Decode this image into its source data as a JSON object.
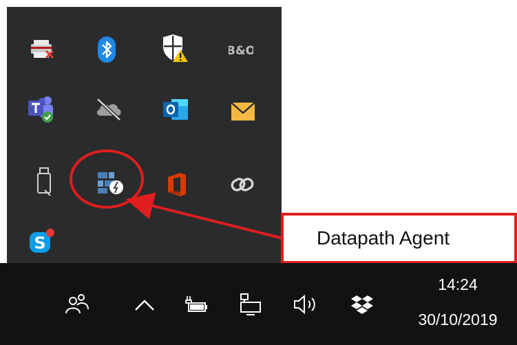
{
  "flyout": {
    "icons": [
      {
        "name": "printer-error-icon",
        "label": ""
      },
      {
        "name": "bluetooth-icon",
        "label": ""
      },
      {
        "name": "windows-security-warning-icon",
        "label": ""
      },
      {
        "name": "bang-olufsen-icon",
        "label": "B&O"
      },
      {
        "name": "teams-icon",
        "label": ""
      },
      {
        "name": "onedrive-offline-icon",
        "label": ""
      },
      {
        "name": "outlook-icon",
        "label": ""
      },
      {
        "name": "mail-icon",
        "label": ""
      },
      {
        "name": "usb-drive-icon",
        "label": ""
      },
      {
        "name": "datapath-agent-icon",
        "label": ""
      },
      {
        "name": "office-icon",
        "label": ""
      },
      {
        "name": "link-icon",
        "label": ""
      },
      {
        "name": "skype-icon",
        "label": ""
      }
    ]
  },
  "annotation": {
    "callout_text": "Datapath Agent",
    "color": "#e01e1e"
  },
  "taskbar": {
    "icons": [
      "people-icon",
      "chevron-up-icon",
      "battery-icon",
      "network-icon",
      "volume-icon",
      "dropbox-icon"
    ],
    "clock": {
      "time": "14:24",
      "date": "30/10/2019"
    }
  },
  "colors": {
    "flyout_bg": "#2a2b2d",
    "taskbar_bg": "#111214",
    "accent_blue": "#1e88e5",
    "office_orange": "#d83b01"
  }
}
